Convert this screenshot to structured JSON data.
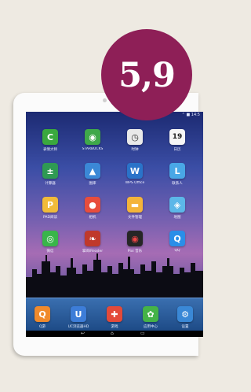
{
  "badge": {
    "text": "5,9",
    "color": "#8e1f57"
  },
  "status_bar": {
    "text": "⌃ ■ 14:5"
  },
  "apps": [
    {
      "label": "表情大师",
      "icon": "green-circle-icon",
      "glyph": "C",
      "color": "#3aa83e"
    },
    {
      "label": "STARBUCKS",
      "icon": "wifi-icon",
      "glyph": "◉",
      "color": "#3fa84a"
    },
    {
      "label": "时钟",
      "icon": "clock-icon",
      "glyph": "◷",
      "color": "#e9e9e9"
    },
    {
      "label": "日历",
      "icon": "calendar-icon",
      "glyph": "19",
      "color": "#f6f6f6"
    },
    {
      "label": "计算器",
      "icon": "calculator-icon",
      "glyph": "±",
      "color": "#2f9a53"
    },
    {
      "label": "图库",
      "icon": "gallery-icon",
      "glyph": "▲",
      "color": "#3b88d6"
    },
    {
      "label": "WPS Office",
      "icon": "wps-icon",
      "glyph": "W",
      "color": "#2a73c9"
    },
    {
      "label": "联系人",
      "icon": "contacts-icon",
      "glyph": "L",
      "color": "#49a7e6"
    },
    {
      "label": "PAD阅读",
      "icon": "reader-icon",
      "glyph": "P",
      "color": "#f1bb39"
    },
    {
      "label": "相机",
      "icon": "camera-icon",
      "glyph": "●",
      "color": "#e84d3d"
    },
    {
      "label": "文件管理",
      "icon": "folder-icon",
      "glyph": "▬",
      "color": "#f4b43a"
    },
    {
      "label": "地图",
      "icon": "map-icon",
      "glyph": "◈",
      "color": "#5cb7e8"
    },
    {
      "label": "微信",
      "icon": "wechat-icon",
      "glyph": "◎",
      "color": "#39b54a"
    },
    {
      "label": "掌阅iReader",
      "icon": "ireader-icon",
      "glyph": "❧",
      "color": "#c0392b"
    },
    {
      "label": "Pixi 音乐",
      "icon": "music-icon",
      "glyph": "◉",
      "color": "#262626"
    },
    {
      "label": "QQ",
      "icon": "qq-icon",
      "glyph": "Q",
      "color": "#2a8ee8"
    }
  ],
  "dock_apps": [
    {
      "label": "Q游",
      "icon": "game-center-icon",
      "glyph": "Q",
      "color": "#f08a2c"
    },
    {
      "label": "UC浏览器HD",
      "icon": "uc-browser-icon",
      "glyph": "U",
      "color": "#3d7dd8"
    },
    {
      "label": "游戏",
      "icon": "gamepad-icon",
      "glyph": "✚",
      "color": "#e34a3a"
    },
    {
      "label": "应用中心",
      "icon": "app-store-icon",
      "glyph": "✿",
      "color": "#45b347"
    },
    {
      "label": "设置",
      "icon": "settings-icon",
      "glyph": "⚙",
      "color": "#3a88d6"
    }
  ],
  "navbar": {
    "back": "↩",
    "home": "⌂",
    "recent": "▭"
  }
}
